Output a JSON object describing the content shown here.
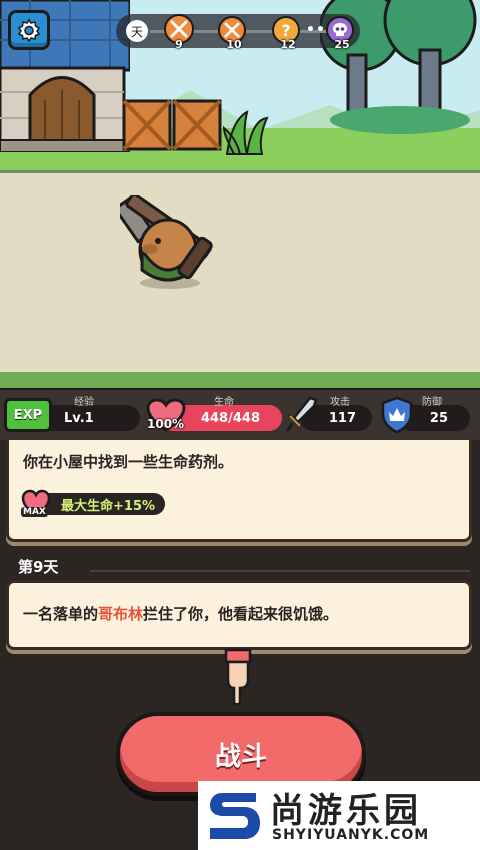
{
  "hud": {
    "day_label": "天",
    "nodes": [
      {
        "number": "9",
        "icon": "crossed-swords-icon",
        "color": "#f08a3c"
      },
      {
        "number": "10",
        "icon": "crossed-swords-icon",
        "color": "#f08a3c"
      },
      {
        "number": "12",
        "icon": "question-mark-icon",
        "color": "#f2a93a"
      },
      {
        "number": "25",
        "icon": "skull-icon",
        "color": "#9b6bd3"
      }
    ],
    "dots": "•••"
  },
  "stats": {
    "exp": {
      "badge": "EXP",
      "label": "经验",
      "value": "Lv.1",
      "color": "#4fc13c"
    },
    "hp": {
      "label": "生命",
      "percent": "100%",
      "value": "448/448",
      "color": "#e8455c"
    },
    "attack": {
      "label": "攻击",
      "value": "117",
      "icon": "sword-icon"
    },
    "defense": {
      "label": "防御",
      "value": "25",
      "icon": "shield-icon"
    }
  },
  "log": {
    "entry1": {
      "text": "你在小屋中找到一些生命药剂。",
      "buff_text": "最大生命+15%",
      "buff_icon_label": "MAX"
    },
    "day_heading": "第9天",
    "entry2": {
      "before": "一名落单的",
      "enemy": "哥布林",
      "after": "拦住了你，他看起来很饥饿。"
    }
  },
  "fight_button": {
    "label": "战斗"
  },
  "watermark": {
    "title": "尚游乐园",
    "url": "SHYIYUANYK.COM"
  }
}
